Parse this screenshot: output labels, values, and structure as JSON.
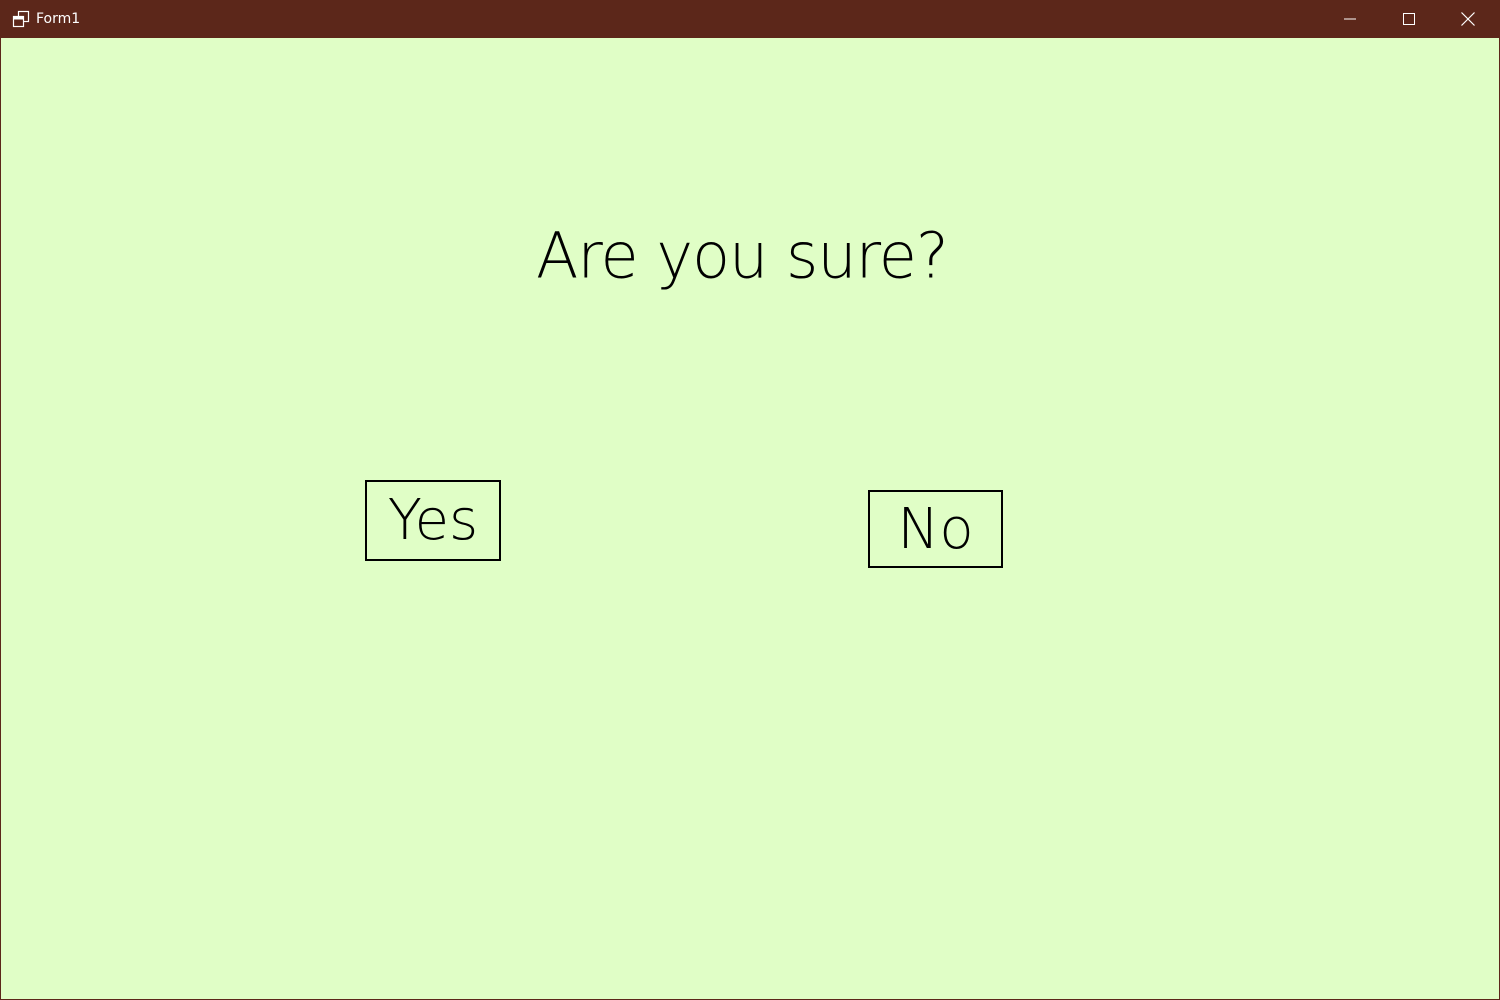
{
  "window": {
    "title": "Form1",
    "icon": "app-window-icon",
    "titlebar_color": "#5c271a",
    "background_color": "#e0fec6",
    "controls": {
      "minimize_icon": "minimize-icon",
      "maximize_icon": "maximize-icon",
      "close_icon": "close-icon"
    }
  },
  "dialog": {
    "question": "Are you sure?",
    "yes_label": "Yes",
    "no_label": "No"
  }
}
